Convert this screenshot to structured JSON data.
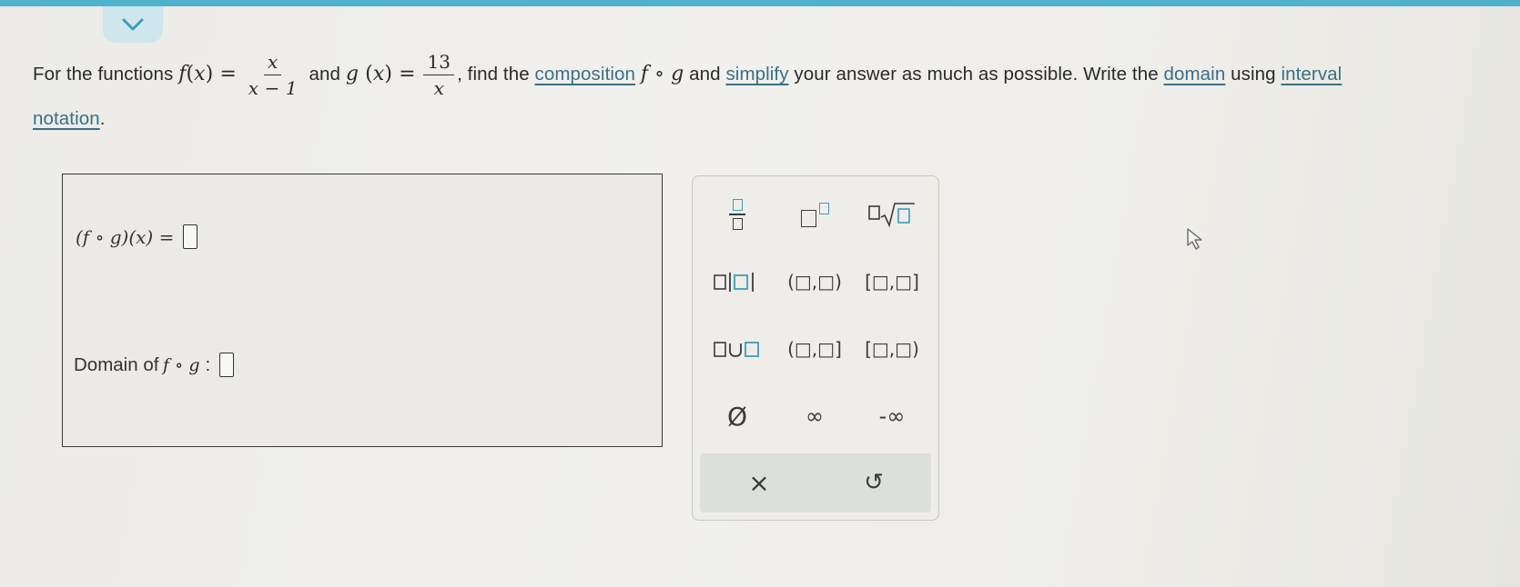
{
  "problem": {
    "intro": "For the functions",
    "f_name": "f",
    "x_var": "x",
    "f_num": "x",
    "f_den": "x − 1",
    "and": "and",
    "g_name": "g",
    "g_num": "13",
    "g_den": "x",
    "mid": ", find the",
    "link_composition": "composition",
    "comp_expr": "f ∘ g",
    "and2": "and",
    "link_simplify": "simplify",
    "mid2": "your answer as much as possible. Write the",
    "link_domain": "domain",
    "using": "using",
    "link_interval": "interval",
    "link_notation": "notation",
    "period": "."
  },
  "answer": {
    "expr": "(f ∘ g)(x) =",
    "domain_label": "Domain of",
    "domain_expr": "f ∘ g",
    "colon": ":"
  },
  "keypad": {
    "interval_open": "(□,□)",
    "interval_closed": "[□,□]",
    "interval_open_closed": "(□,□]",
    "interval_closed_open": "[□,□)",
    "empty_set": "Ø",
    "infinity": "∞",
    "neg_infinity": "-∞",
    "clear": "×",
    "undo": "↺"
  },
  "colors": {
    "accent": "#4fb3cb",
    "link": "#3a6f85",
    "square_teal": "#3f9db6"
  }
}
